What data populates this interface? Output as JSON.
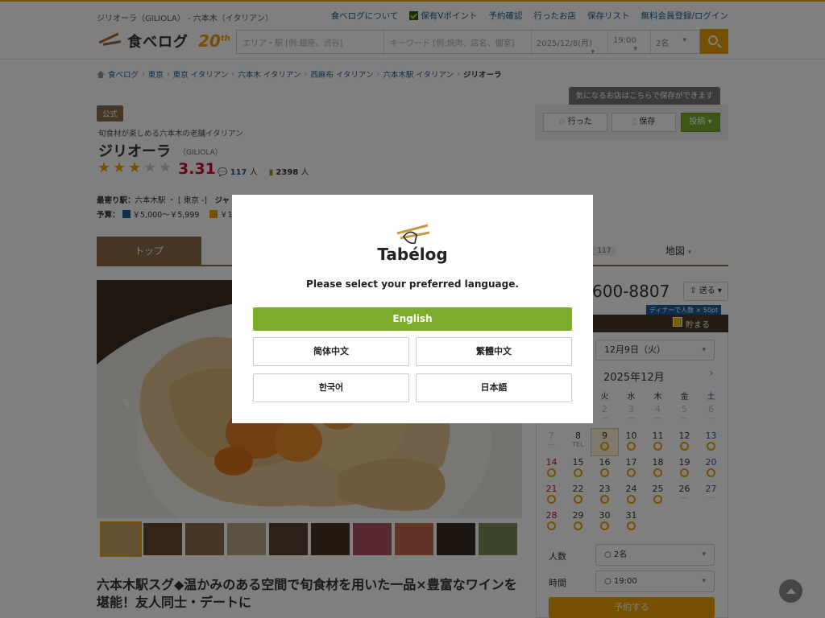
{
  "header": {
    "area_title": "ジリオーラ（GILIOLA） - 六本木（イタリアン）",
    "links": [
      "食べログについて",
      "保有Vポイント",
      "予約確認",
      "行ったお店",
      "保存リスト",
      "無料会員登録/ログイン"
    ],
    "logo_text": "食べログ",
    "logo_anniv": "20",
    "logo_anniv_sup": "th",
    "search": {
      "area_placeholder": "エリア・駅 [例:銀座、渋谷]",
      "keyword_placeholder": "キーワード [例:焼肉、店名、個室]",
      "date": "2025/12/8(月)",
      "time": "19:00",
      "people": "2名"
    }
  },
  "breadcrumb": [
    "食べログ",
    "東京",
    "東京 イタリアン",
    "六本木 イタリアン",
    "西麻布 イタリアン",
    "六本木駅 イタリアン"
  ],
  "breadcrumb_current": "ジリオーラ",
  "save_tooltip": "気になるお店はこちらで保存ができます",
  "actions": {
    "went": "行った",
    "save": "保存",
    "post": "投稿"
  },
  "restaurant": {
    "official_badge": "公式",
    "catch": "旬食材が楽しめる六本木の老舗イタリアン",
    "name": "ジリオーラ",
    "name_en": "（GILIOLA）",
    "rating_stars": 3,
    "rating": "3.31",
    "review_count": "117",
    "review_unit": "人",
    "save_count": "2398",
    "save_unit": "人",
    "nearest_label": "最寄り駅：",
    "nearest_value": "六本木駅 ・ [ 東京 -]",
    "genre_label": "ジャ",
    "budget_label": "予算：",
    "budget_dinner": "￥5,000～￥5,999",
    "budget_lunch": "￥1,00"
  },
  "tabs": {
    "top": "トップ",
    "count": "117",
    "map": "地図"
  },
  "description": "六本木駅スグ◆温かみのある空間で旬食材を用いた一品×豊富なワインを堪能！友人同士・デートに",
  "reservation": {
    "phone": "600-8807",
    "send": "送る",
    "dinner_badge": "ディナーで人数 × 50pt",
    "save_label": "貯まる",
    "selected_date": "12月9日（火）",
    "month_label": "2025年12月",
    "weekdays": [
      "月",
      "火",
      "水",
      "木",
      "金",
      "土"
    ],
    "people_label": "人数",
    "people_value": "○ 2名",
    "time_label": "時間",
    "time_value": "○ 19:00",
    "reserve_button": "予約する"
  },
  "language_modal": {
    "logo_text": "Tabélog",
    "prompt": "Please select your preferred language.",
    "english": "English",
    "simplified_chinese": "简体中文",
    "traditional_chinese": "繁體中文",
    "korean": "한국어",
    "japanese": "日本語"
  },
  "colors": {
    "brand": "#e8a000",
    "accent_green": "#7bad2a",
    "rating_red": "#c8102e",
    "tab_brown": "#8a6d4a"
  }
}
